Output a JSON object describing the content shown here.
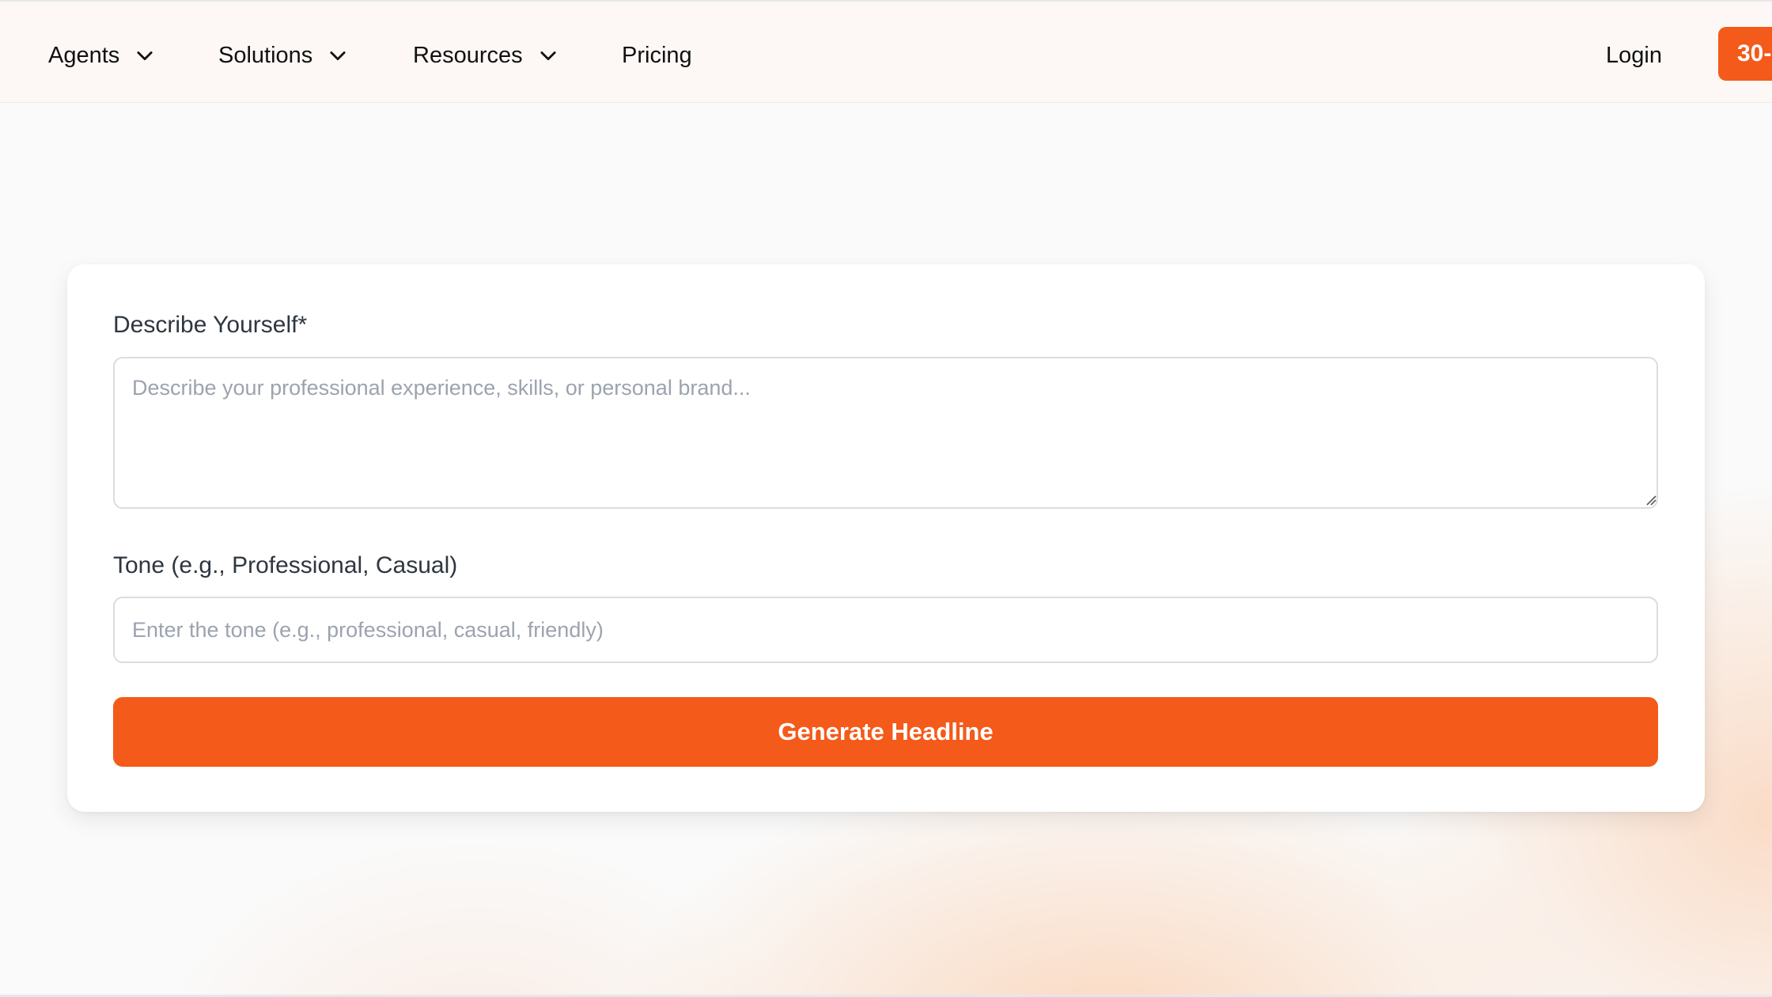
{
  "nav": {
    "items": [
      {
        "label": "Agents",
        "icon": "chevron-down-icon"
      },
      {
        "label": "Solutions",
        "icon": "chevron-down-icon"
      },
      {
        "label": "Resources",
        "icon": "chevron-down-icon"
      },
      {
        "label": "Pricing"
      }
    ],
    "login_label": "Login",
    "cta_label": "30-"
  },
  "form": {
    "describe_label": "Describe Yourself*",
    "describe_placeholder": "Describe your professional experience, skills, or personal brand...",
    "describe_value": "",
    "tone_label": "Tone (e.g., Professional, Casual)",
    "tone_placeholder": "Enter the tone (e.g., professional, casual, friendly)",
    "tone_value": "",
    "submit_label": "Generate Headline"
  },
  "colors": {
    "accent": "#f45a1a",
    "nav_bg": "#fdf8f5",
    "page_bg": "#fafafa",
    "border": "#d9dce1"
  }
}
